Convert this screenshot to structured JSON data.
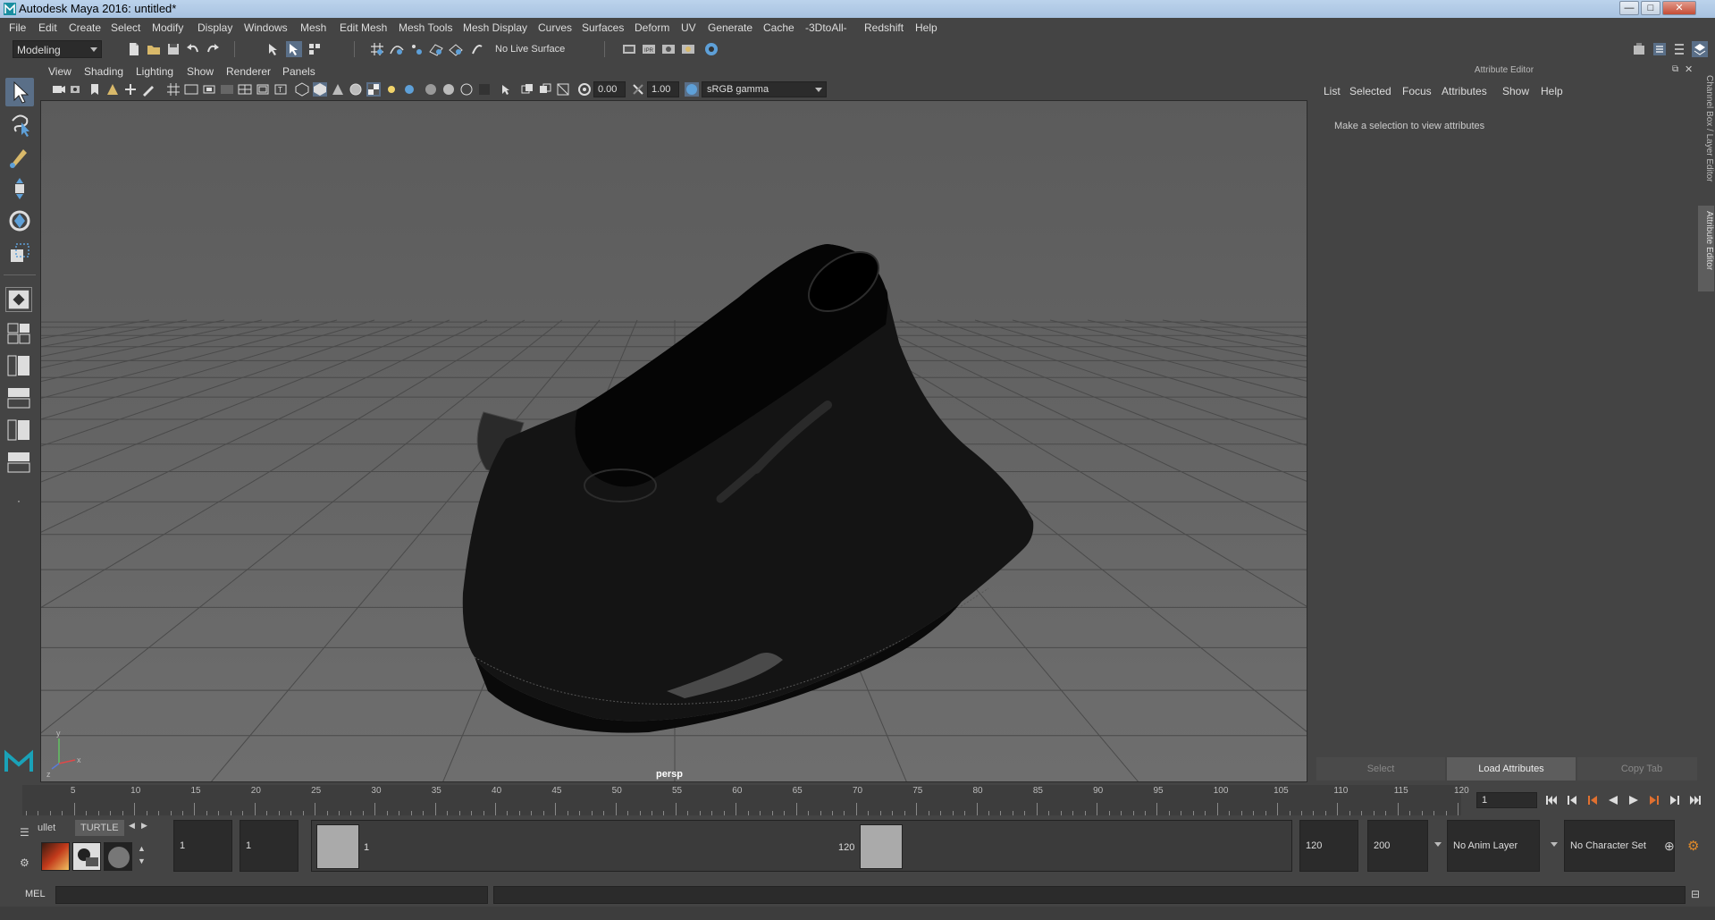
{
  "window": {
    "title": "Autodesk Maya 2016: untitled*",
    "minimize_glyph": "—",
    "maximize_glyph": "□",
    "close_glyph": "✕"
  },
  "menubar": {
    "items": [
      "File",
      "Edit",
      "Create",
      "Select",
      "Modify",
      "Display",
      "Windows",
      "Mesh",
      "Edit Mesh",
      "Mesh Tools",
      "Mesh Display",
      "Curves",
      "Surfaces",
      "Deform",
      "UV",
      "Generate",
      "Cache",
      "-3DtoAll-",
      "Redshift",
      "Help"
    ]
  },
  "statusline": {
    "menuset": "Modeling",
    "live_surface": "No Live Surface"
  },
  "viewport": {
    "panel_menus": [
      "View",
      "Shading",
      "Lighting",
      "Show",
      "Renderer",
      "Panels"
    ],
    "exposure": "0.00",
    "gamma": "1.00",
    "color_space": "sRGB gamma",
    "camera": "persp",
    "axis_x": "x",
    "axis_y": "y",
    "axis_z": "z",
    "colors": {
      "background_top": "#5b5b5b",
      "background_bottom": "#6e6e6e",
      "grid": "#4a4a4a",
      "model": "#111111"
    }
  },
  "attribute_editor": {
    "title": "Attribute Editor",
    "menus": [
      "List",
      "Selected",
      "Focus",
      "Attributes",
      "Show",
      "Help"
    ],
    "message": "Make a selection to view attributes",
    "buttons": {
      "select": "Select",
      "load": "Load Attributes",
      "copy_tab": "Copy Tab"
    }
  },
  "side_tabs": {
    "channel_box": "Channel Box / Layer Editor",
    "attribute_editor": "Attribute Editor"
  },
  "timeline": {
    "ticks": [
      "5",
      "10",
      "15",
      "20",
      "25",
      "30",
      "35",
      "40",
      "45",
      "50",
      "55",
      "60",
      "65",
      "70",
      "75",
      "80",
      "85",
      "90",
      "95",
      "100",
      "105",
      "110",
      "115",
      "120"
    ],
    "start_marker": "1",
    "current_frame": "1"
  },
  "range": {
    "start_time": "1",
    "playback_start": "1",
    "range_start_label": "1",
    "range_end_label": "120",
    "playback_end": "120",
    "end_time": "200",
    "anim_layer": "No Anim Layer",
    "character_set": "No Character Set"
  },
  "shelf": {
    "tabs": [
      "ullet",
      "TURTLE"
    ]
  },
  "command_line": {
    "language": "MEL"
  }
}
